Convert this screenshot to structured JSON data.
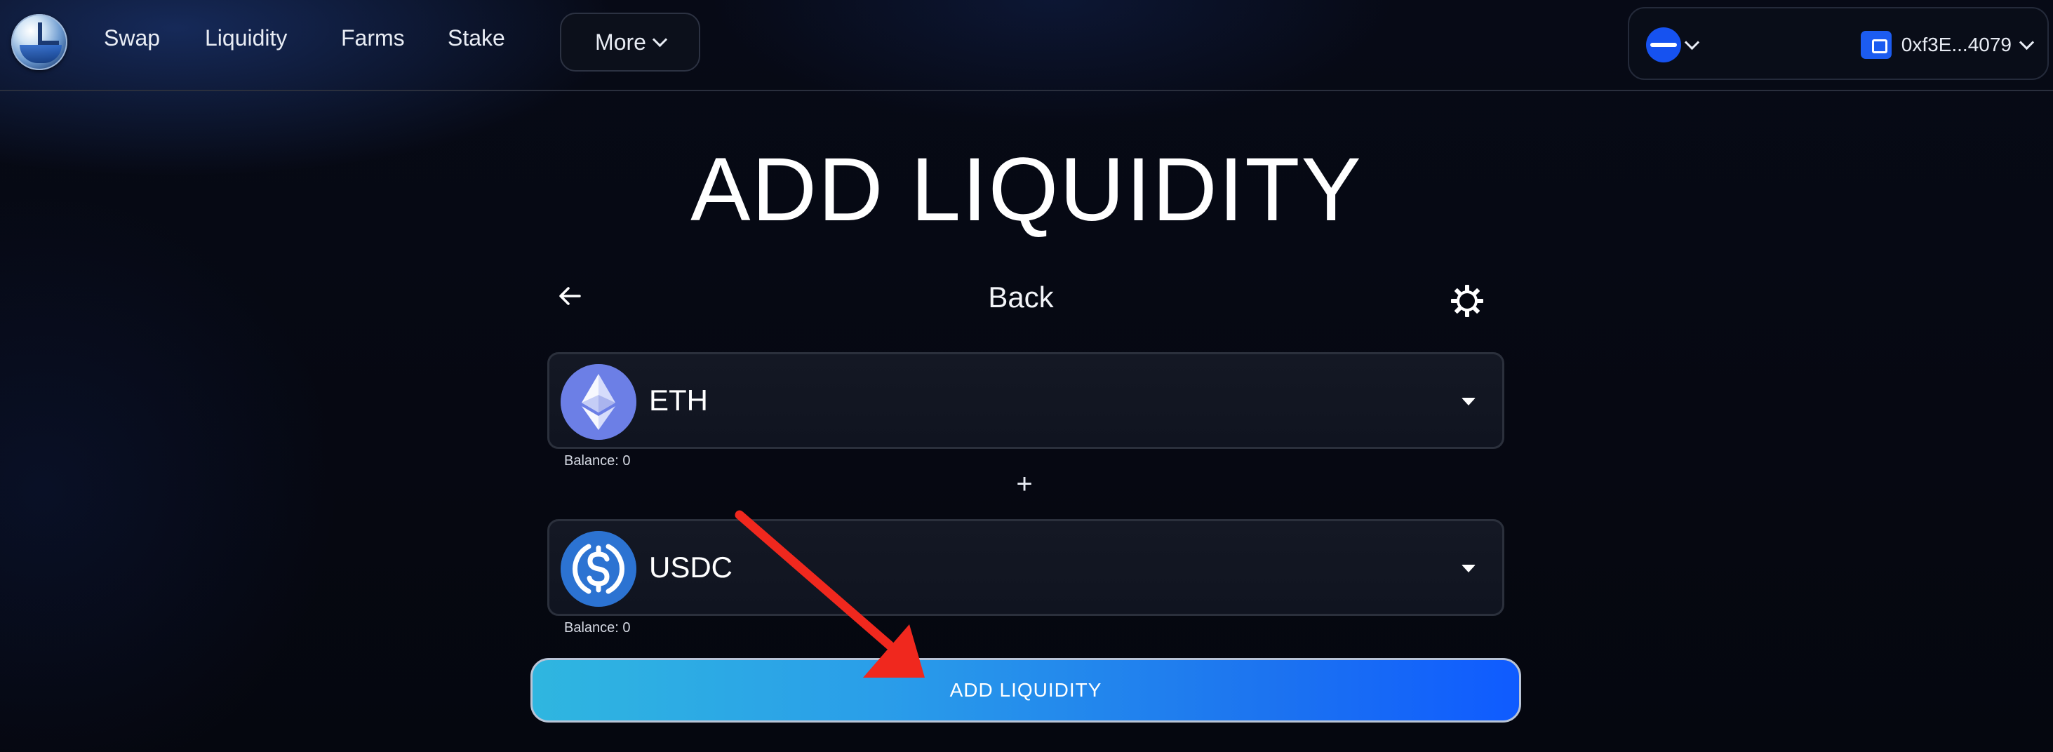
{
  "nav": {
    "links": [
      {
        "label": "Swap"
      },
      {
        "label": "Liquidity"
      },
      {
        "label": "Farms"
      },
      {
        "label": "Stake"
      }
    ],
    "more_label": "More",
    "wallet": {
      "address": "0xf3E...4079",
      "network_icon": "base-network-icon"
    }
  },
  "main": {
    "title": "ADD LIQUIDITY",
    "back_label": "Back",
    "token_a": {
      "symbol": "ETH",
      "balance": "Balance: 0",
      "icon": "eth-icon"
    },
    "plus_symbol": "+",
    "token_b": {
      "symbol": "USDC",
      "balance": "Balance: 0",
      "icon": "usdc-icon"
    },
    "submit_label": "ADD LIQUIDITY"
  },
  "colors": {
    "background": "#04060d",
    "button_gradient_start": "#2fb6e0",
    "button_gradient_end": "#0f5bff",
    "annotation_arrow": "#f0281e"
  }
}
